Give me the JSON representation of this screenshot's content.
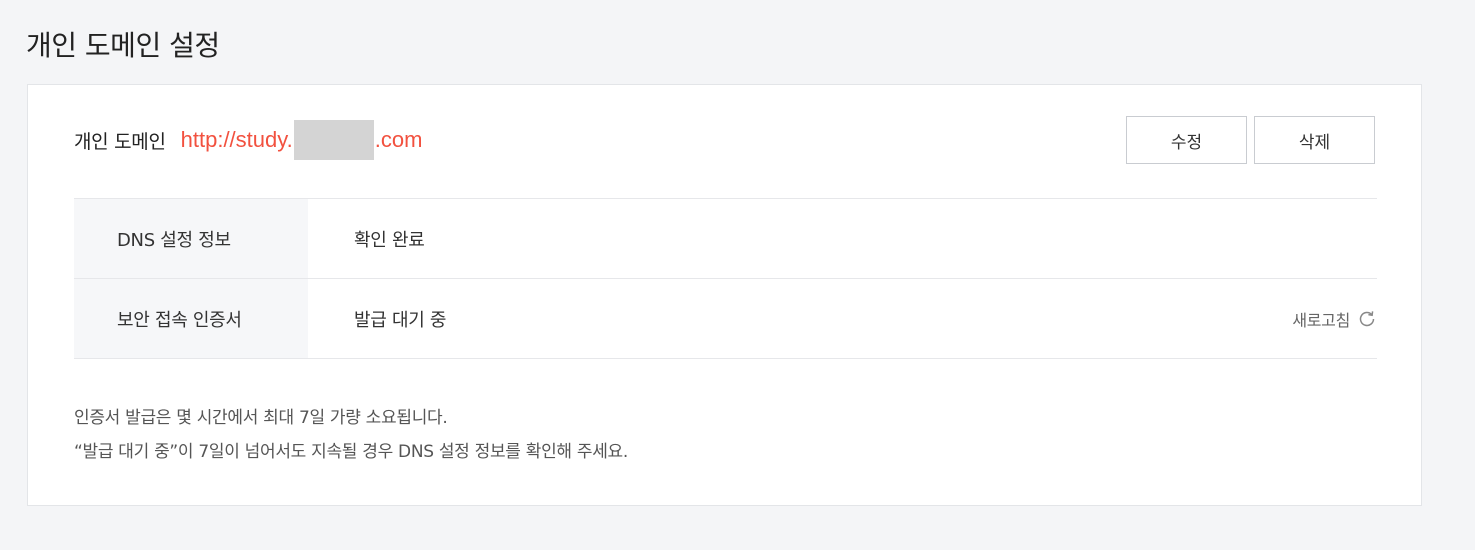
{
  "page": {
    "title": "개인 도메인 설정"
  },
  "domain": {
    "label": "개인 도메인",
    "url_prefix": "http://study.",
    "url_suffix": ".com",
    "edit_label": "수정",
    "delete_label": "삭제"
  },
  "info": {
    "rows": [
      {
        "label": "DNS 설정 정보",
        "value": "확인 완료"
      },
      {
        "label": "보안 접속 인증서",
        "value": "발급 대기 중"
      }
    ],
    "refresh_label": "새로고침",
    "refresh_icon": "refresh-icon"
  },
  "notes": {
    "line1": "인증서 발급은 몇 시간에서 최대 7일 가량 소요됩니다.",
    "line2": "“발급 대기 중”이 7일이 넘어서도 지속될 경우 DNS 설정 정보를 확인해 주세요."
  },
  "colors": {
    "url": "#f2513f",
    "background": "#f4f5f7",
    "header_cell": "#f6f7f9"
  }
}
